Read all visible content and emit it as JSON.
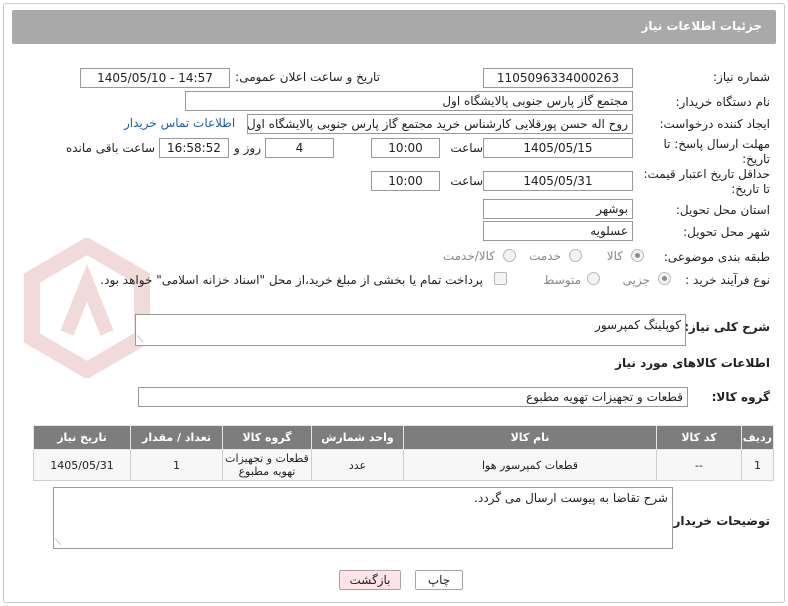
{
  "header": {
    "title": "جزئیات اطلاعات نیاز"
  },
  "form": {
    "need_number_label": "شماره نیاز:",
    "need_number": "1105096334000263",
    "announce_label": "تاریخ و ساعت اعلان عمومی:",
    "announce_value": "1405/05/10 - 14:57",
    "buyer_org_label": "نام دستگاه خریدار:",
    "buyer_org": "مجتمع گاز پارس جنوبی  پالایشگاه اول",
    "creator_label": "ایجاد کننده درخواست:",
    "creator": "روح اله حسن پورقلایی کارشناس خرید مجتمع گاز پارس جنوبی  پالایشگاه اول",
    "contact_link": "اطلاعات تماس خریدار",
    "reply_deadline_label": "مهلت ارسال پاسخ: تا تاریخ:",
    "reply_date": "1405/05/15",
    "time_label": "ساعت",
    "reply_time": "10:00",
    "days_value": "4",
    "days_label": "روز و",
    "remaining_time": "16:58:52",
    "remaining_label": "ساعت باقی مانده",
    "price_valid_label": "حداقل تاریخ اعتبار قیمت: تا تاریخ:",
    "price_valid_date": "1405/05/31",
    "price_valid_time": "10:00",
    "province_label": "استان محل تحویل:",
    "province": "بوشهر",
    "city_label": "شهر محل تحویل:",
    "city": "عسلویه",
    "category_label": "طبقه بندی موضوعی:",
    "category_options": [
      "کالا",
      "خدمت",
      "کالا/خدمت"
    ],
    "category_selected": 0,
    "process_label": "نوع فرآیند خرید :",
    "process_options": [
      "جزیی",
      "متوسط"
    ],
    "process_selected": 0,
    "payment_note": "پرداخت تمام یا بخشی از مبلغ خرید،از محل \"اسناد خزانه اسلامی\" خواهد بود."
  },
  "summary": {
    "label": "شرح کلی نیاز:",
    "value": "کوپلینگ کمپرسور"
  },
  "goods": {
    "section_title": "اطلاعات کالاهای مورد نیاز",
    "group_label": "گروه کالا:",
    "group_value": "قطعات و تجهیزات تهویه مطبوع",
    "columns": [
      "ردیف",
      "کد کالا",
      "نام کالا",
      "واحد شمارش",
      "گروه کالا",
      "تعداد / مقدار",
      "تاریخ نیاز"
    ],
    "rows": [
      [
        "1",
        "--",
        "قطعات کمپرسور هوا",
        "عدد",
        "قطعات و تجهیزات تهویه مطبوع",
        "1",
        "1405/05/31"
      ]
    ]
  },
  "notes": {
    "label": "توضیحات خریدار:",
    "value": "شرح تقاضا به پیوست ارسال می گردد."
  },
  "buttons": {
    "print": "چاپ",
    "back": "بازگشت"
  },
  "colors": {
    "header_bg": "#a9a9a9",
    "table_header_bg": "#7d7d7d",
    "link": "#1a5fb4",
    "back_button_bg": "#ffe3e6"
  }
}
